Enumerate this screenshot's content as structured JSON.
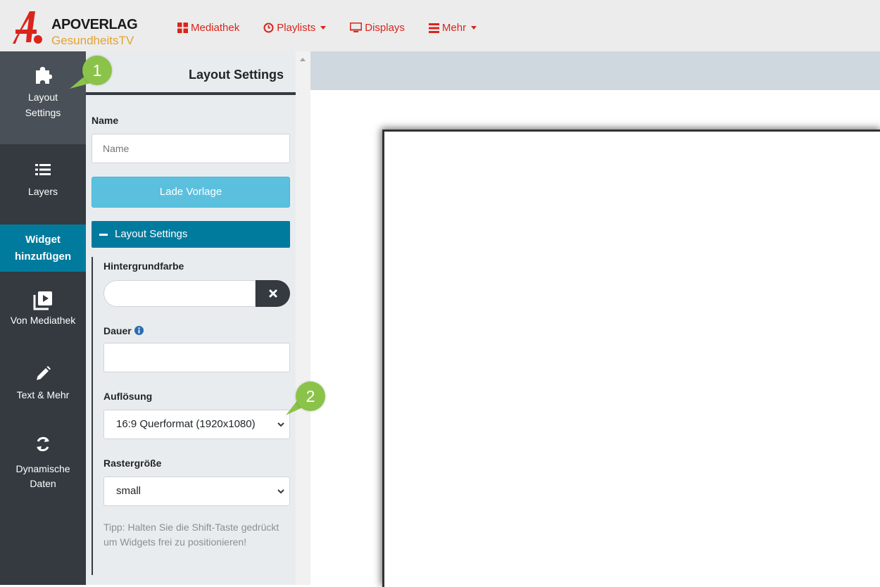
{
  "brand": {
    "name": "APOVERLAG",
    "subtitle": "GesundheitsTV",
    "primary_color": "#d9251c",
    "accent_color": "#e5a233"
  },
  "nav": {
    "mediathek": "Mediathek",
    "playlists": "Playlists",
    "displays": "Displays",
    "mehr": "Mehr"
  },
  "sidebar": {
    "layout_settings": [
      "Layout",
      "Settings"
    ],
    "layers": "Layers",
    "widget_header": [
      "Widget",
      "hinzufügen"
    ],
    "von_mediathek": "Von Mediathek",
    "text_mehr": "Text & Mehr",
    "dynamische_daten": [
      "Dynamische",
      "Daten"
    ]
  },
  "panel": {
    "title": "Layout Settings",
    "name_label": "Name",
    "name_placeholder": "Name",
    "name_value": "",
    "load_template_button": "Lade Vorlage",
    "section_title": "Layout Settings",
    "background_label": "Hintergrundfarbe",
    "duration_label": "Dauer",
    "duration_value": "",
    "resolution_label": "Auflösung",
    "resolution_value": "16:9 Querformat (1920x1080)",
    "grid_label": "Rastergröße",
    "grid_value": "small",
    "hint": "Tipp: Halten Sie die Shift-Taste gedrückt um Widgets frei zu positionieren!"
  },
  "annotations": {
    "step1": "1",
    "step2": "2"
  }
}
